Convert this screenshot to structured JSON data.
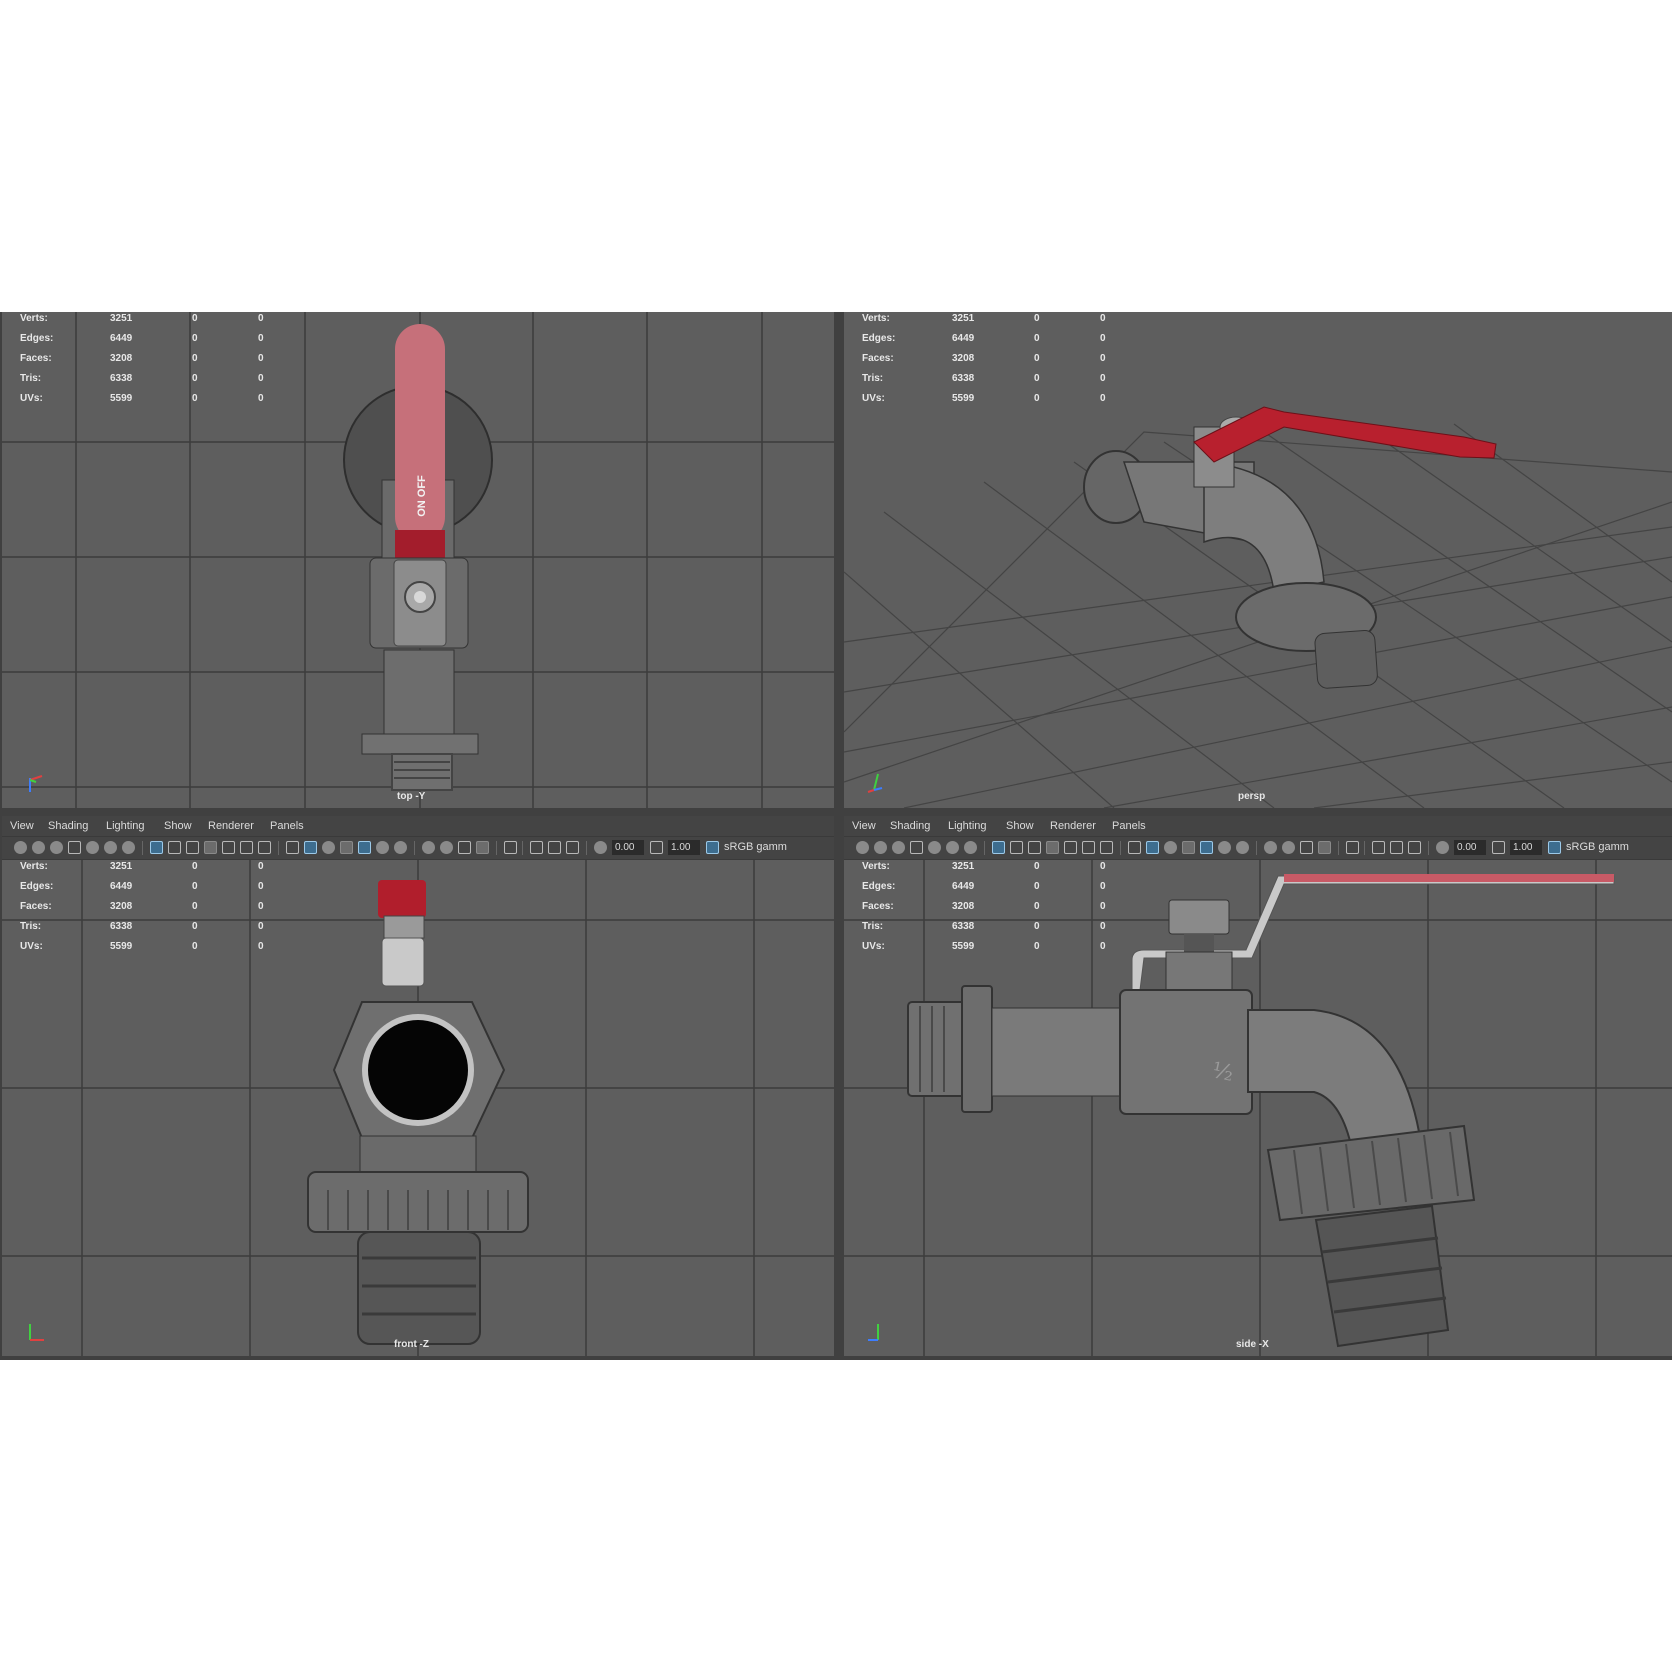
{
  "menu": [
    "View",
    "Shading",
    "Lighting",
    "Show",
    "Renderer",
    "Panels"
  ],
  "toolbar": {
    "field_a": "0.00",
    "field_b": "1.00",
    "color_space": "sRGB gamm"
  },
  "stat_labels": [
    "Verts:",
    "Edges:",
    "Faces:",
    "Tris:",
    "UVs:"
  ],
  "stat_values": [
    [
      "3251",
      "0",
      "0"
    ],
    [
      "6449",
      "0",
      "0"
    ],
    [
      "3208",
      "0",
      "0"
    ],
    [
      "6338",
      "0",
      "0"
    ],
    [
      "5599",
      "0",
      "0"
    ]
  ],
  "viewports": [
    {
      "camera": "top -Y"
    },
    {
      "camera": "persp"
    },
    {
      "camera": "front -Z"
    },
    {
      "camera": "side -X"
    }
  ],
  "handle_text": "ON OFF",
  "size_mark": "½",
  "colors": {
    "viewport_bg": "#5e5e5e",
    "handle_red": "#c02030",
    "metal": "#7b7b7b"
  }
}
